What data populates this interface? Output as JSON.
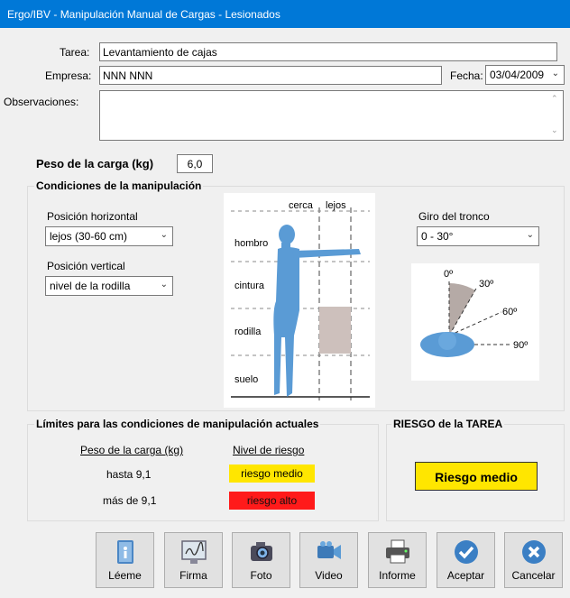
{
  "window": {
    "title": "Ergo/IBV - Manipulación Manual de Cargas - Lesionados"
  },
  "form": {
    "tarea_label": "Tarea:",
    "tarea_value": "Levantamiento de cajas",
    "empresa_label": "Empresa:",
    "empresa_value": "NNN NNN",
    "fecha_label": "Fecha:",
    "fecha_value": "03/04/2009",
    "observaciones_label": "Observaciones:",
    "observaciones_value": ""
  },
  "peso": {
    "label": "Peso de la carga (kg)",
    "value": "6,0"
  },
  "condiciones": {
    "title": "Condiciones de la manipulación",
    "pos_horizontal_label": "Posición horizontal",
    "pos_horizontal_value": "lejos (30-60 cm)",
    "pos_vertical_label": "Posición vertical",
    "pos_vertical_value": "nivel de la rodilla",
    "giro_label": "Giro del tronco",
    "giro_value": "0 - 30°",
    "figure": {
      "cerca": "cerca",
      "lejos": "lejos",
      "hombro": "hombro",
      "cintura": "cintura",
      "rodilla": "rodilla",
      "suelo": "suelo"
    },
    "angles": {
      "a0": "0º",
      "a30": "30º",
      "a60": "60º",
      "a90": "90º"
    }
  },
  "limites": {
    "title": "Límites para las condiciones de manipulación actuales",
    "col_peso": "Peso de la carga (kg)",
    "col_nivel": "Nivel de riesgo",
    "rows": [
      {
        "peso": "hasta 9,1",
        "nivel": "riesgo medio",
        "color": "#ffe600"
      },
      {
        "peso": "más de 9,1",
        "nivel": "riesgo alto",
        "color": "#ff1a1a"
      }
    ]
  },
  "riesgo": {
    "title": "RIESGO de la TAREA",
    "value": "Riesgo medio",
    "color": "#ffe600"
  },
  "buttons": {
    "leeme": "Léeme",
    "firma": "Firma",
    "foto": "Foto",
    "video": "Video",
    "informe": "Informe",
    "aceptar": "Aceptar",
    "cancelar": "Cancelar"
  }
}
